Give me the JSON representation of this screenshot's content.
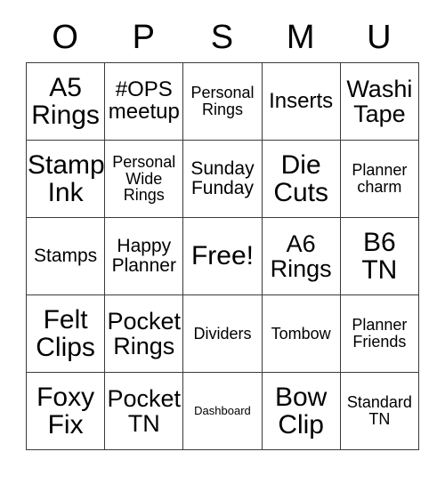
{
  "card": {
    "headers": [
      "O",
      "P",
      "S",
      "M",
      "U"
    ],
    "rows": [
      [
        {
          "text": "A5\nRings",
          "size": "xxl"
        },
        {
          "text": "#OPS\nmeetup",
          "size": "l"
        },
        {
          "text": "Personal\nRings",
          "size": "s"
        },
        {
          "text": "Inserts",
          "size": "l"
        },
        {
          "text": "Washi\nTape",
          "size": "xl"
        }
      ],
      [
        {
          "text": "Stamp\nInk",
          "size": "xxl"
        },
        {
          "text": "Personal\nWide\nRings",
          "size": "s"
        },
        {
          "text": "Sunday\nFunday",
          "size": "m"
        },
        {
          "text": "Die\nCuts",
          "size": "xxl"
        },
        {
          "text": "Planner\ncharm",
          "size": "s"
        }
      ],
      [
        {
          "text": "Stamps",
          "size": "m"
        },
        {
          "text": "Happy\nPlanner",
          "size": "m"
        },
        {
          "text": "Free!",
          "size": "xxl"
        },
        {
          "text": "A6\nRings",
          "size": "xl"
        },
        {
          "text": "B6\nTN",
          "size": "xxl"
        }
      ],
      [
        {
          "text": "Felt\nClips",
          "size": "xxl"
        },
        {
          "text": "Pocket\nRings",
          "size": "xl"
        },
        {
          "text": "Dividers",
          "size": "s"
        },
        {
          "text": "Tombow",
          "size": "s"
        },
        {
          "text": "Planner\nFriends",
          "size": "s"
        }
      ],
      [
        {
          "text": "Foxy\nFix",
          "size": "xxl"
        },
        {
          "text": "Pocket\nTN",
          "size": "xl"
        },
        {
          "text": "Dashboard",
          "size": "xxs"
        },
        {
          "text": "Bow\nClip",
          "size": "xxl"
        },
        {
          "text": "Standard\nTN",
          "size": "s"
        }
      ]
    ]
  },
  "colors": {
    "border": "#3a3a3a",
    "background": "#ffffff",
    "text": "#000000"
  }
}
